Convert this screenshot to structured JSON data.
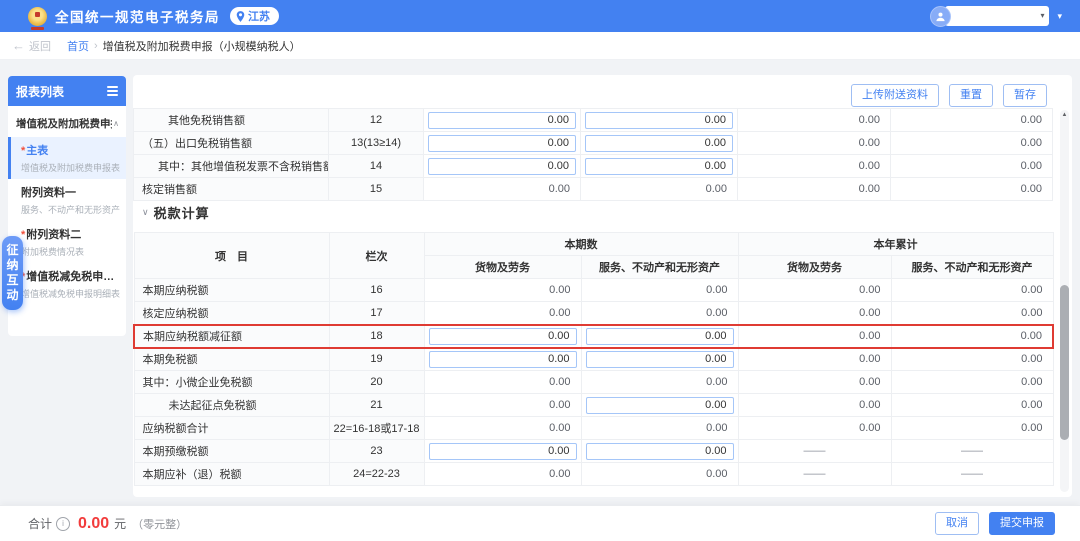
{
  "app": {
    "title": "全国统一规范电子税务局",
    "region": "江苏"
  },
  "breadcrumb": {
    "back_label": "返回",
    "home": "首页",
    "separator": "›",
    "current": "增值税及附加税费申报（小规模纳税人）"
  },
  "icons": {
    "back_arrow": "←",
    "chevron_up": "∧",
    "chevron_down": "∨",
    "scroll_up_arrow": "▲",
    "caret_down": "▾",
    "info": "i"
  },
  "sidebar": {
    "title": "报表列表",
    "group_label": "增值税及附加税费申报...",
    "items": [
      {
        "key": "main-form",
        "label": "主表",
        "sub": "增值税及附加税费申报表",
        "required": true,
        "active": true
      },
      {
        "key": "appendix-1",
        "label": "附列资料一",
        "sub": "服务、不动产和无形资产扣..",
        "required": false,
        "active": false
      },
      {
        "key": "appendix-2",
        "label": "附列资料二",
        "sub": "附加税费情况表",
        "required": true,
        "active": false
      },
      {
        "key": "vat-reduction-detail",
        "label": "增值税减免税申报明...",
        "sub": "增值税减免税申报明细表",
        "required": true,
        "active": false
      }
    ],
    "float_tab": "征纳互动"
  },
  "toolbar": {
    "upload": "上传附送资料",
    "reset": "重置",
    "save_draft": "暂存"
  },
  "upper_table": {
    "rows": [
      {
        "label": "其他免税销售额",
        "indent": 2,
        "col": "12",
        "cells": [
          {
            "type": "input",
            "value": "0.00"
          },
          {
            "type": "input",
            "value": "0.00"
          },
          {
            "type": "text",
            "value": "0.00"
          },
          {
            "type": "text",
            "value": "0.00"
          }
        ]
      },
      {
        "label": "（五）出口免税销售额",
        "indent": 0,
        "col": "13(13≥14)",
        "cells": [
          {
            "type": "input",
            "value": "0.00"
          },
          {
            "type": "input",
            "value": "0.00"
          },
          {
            "type": "text",
            "value": "0.00"
          },
          {
            "type": "text",
            "value": "0.00"
          }
        ]
      },
      {
        "label": "其中：其他增值税发票不含税销售额",
        "indent": 1,
        "col": "14",
        "cells": [
          {
            "type": "input",
            "value": "0.00"
          },
          {
            "type": "input",
            "value": "0.00"
          },
          {
            "type": "text",
            "value": "0.00"
          },
          {
            "type": "text",
            "value": "0.00"
          }
        ]
      },
      {
        "label": "核定销售额",
        "indent": 0,
        "col": "15",
        "cells": [
          {
            "type": "text",
            "value": "0.00"
          },
          {
            "type": "text",
            "value": "0.00"
          },
          {
            "type": "text",
            "value": "0.00"
          },
          {
            "type": "text",
            "value": "0.00"
          }
        ]
      }
    ]
  },
  "section_title": "税款计算",
  "main_table": {
    "header": {
      "item": "项　目",
      "column": "栏次",
      "current_period": "本期数",
      "year_to_date": "本年累计",
      "goods": "货物及劳务",
      "services": "服务、不动产和无形资产"
    },
    "rows": [
      {
        "label": "本期应纳税额",
        "indent": 0,
        "col": "16",
        "highlight": false,
        "cells": [
          {
            "type": "text",
            "value": "0.00"
          },
          {
            "type": "text",
            "value": "0.00"
          },
          {
            "type": "text",
            "value": "0.00"
          },
          {
            "type": "text",
            "value": "0.00"
          }
        ]
      },
      {
        "label": "核定应纳税额",
        "indent": 0,
        "col": "17",
        "highlight": false,
        "cells": [
          {
            "type": "text",
            "value": "0.00"
          },
          {
            "type": "text",
            "value": "0.00"
          },
          {
            "type": "text",
            "value": "0.00"
          },
          {
            "type": "text",
            "value": "0.00"
          }
        ]
      },
      {
        "label": "本期应纳税额减征额",
        "indent": 0,
        "col": "18",
        "highlight": true,
        "cells": [
          {
            "type": "input",
            "value": "0.00"
          },
          {
            "type": "input",
            "value": "0.00"
          },
          {
            "type": "text",
            "value": "0.00"
          },
          {
            "type": "text",
            "value": "0.00"
          }
        ]
      },
      {
        "label": "本期免税额",
        "indent": 0,
        "col": "19",
        "highlight": false,
        "cells": [
          {
            "type": "input",
            "value": "0.00"
          },
          {
            "type": "input",
            "value": "0.00"
          },
          {
            "type": "text",
            "value": "0.00"
          },
          {
            "type": "text",
            "value": "0.00"
          }
        ]
      },
      {
        "label": "其中：小微企业免税额",
        "indent": 0,
        "col": "20",
        "highlight": false,
        "cells": [
          {
            "type": "text",
            "value": "0.00"
          },
          {
            "type": "text",
            "value": "0.00"
          },
          {
            "type": "text",
            "value": "0.00"
          },
          {
            "type": "text",
            "value": "0.00"
          }
        ]
      },
      {
        "label": "未达起征点免税额",
        "indent": 2,
        "col": "21",
        "highlight": false,
        "cells": [
          {
            "type": "text",
            "value": "0.00"
          },
          {
            "type": "input",
            "value": "0.00"
          },
          {
            "type": "text",
            "value": "0.00"
          },
          {
            "type": "text",
            "value": "0.00"
          }
        ]
      },
      {
        "label": "应纳税额合计",
        "indent": 0,
        "col": "22=16-18或17-18",
        "highlight": false,
        "cells": [
          {
            "type": "text",
            "value": "0.00"
          },
          {
            "type": "text",
            "value": "0.00"
          },
          {
            "type": "text",
            "value": "0.00"
          },
          {
            "type": "text",
            "value": "0.00"
          }
        ]
      },
      {
        "label": "本期预缴税额",
        "indent": 0,
        "col": "23",
        "highlight": false,
        "cells": [
          {
            "type": "input",
            "value": "0.00"
          },
          {
            "type": "input",
            "value": "0.00"
          },
          {
            "type": "dash",
            "value": "——"
          },
          {
            "type": "dash",
            "value": "——"
          }
        ]
      },
      {
        "label": "本期应补（退）税额",
        "indent": 0,
        "col": "24=22-23",
        "highlight": false,
        "cells": [
          {
            "type": "text",
            "value": "0.00"
          },
          {
            "type": "text",
            "value": "0.00"
          },
          {
            "type": "dash",
            "value": "——"
          },
          {
            "type": "dash",
            "value": "——"
          }
        ]
      }
    ]
  },
  "footer": {
    "total_label": "合计",
    "total_value": "0.00",
    "unit": "元",
    "amount_in_words": "（零元整）",
    "cancel": "取消",
    "submit": "提交申报"
  },
  "colors": {
    "primary": "#4381F1",
    "highlight_red": "#DF3B33",
    "amount_red": "#F23C3C"
  }
}
